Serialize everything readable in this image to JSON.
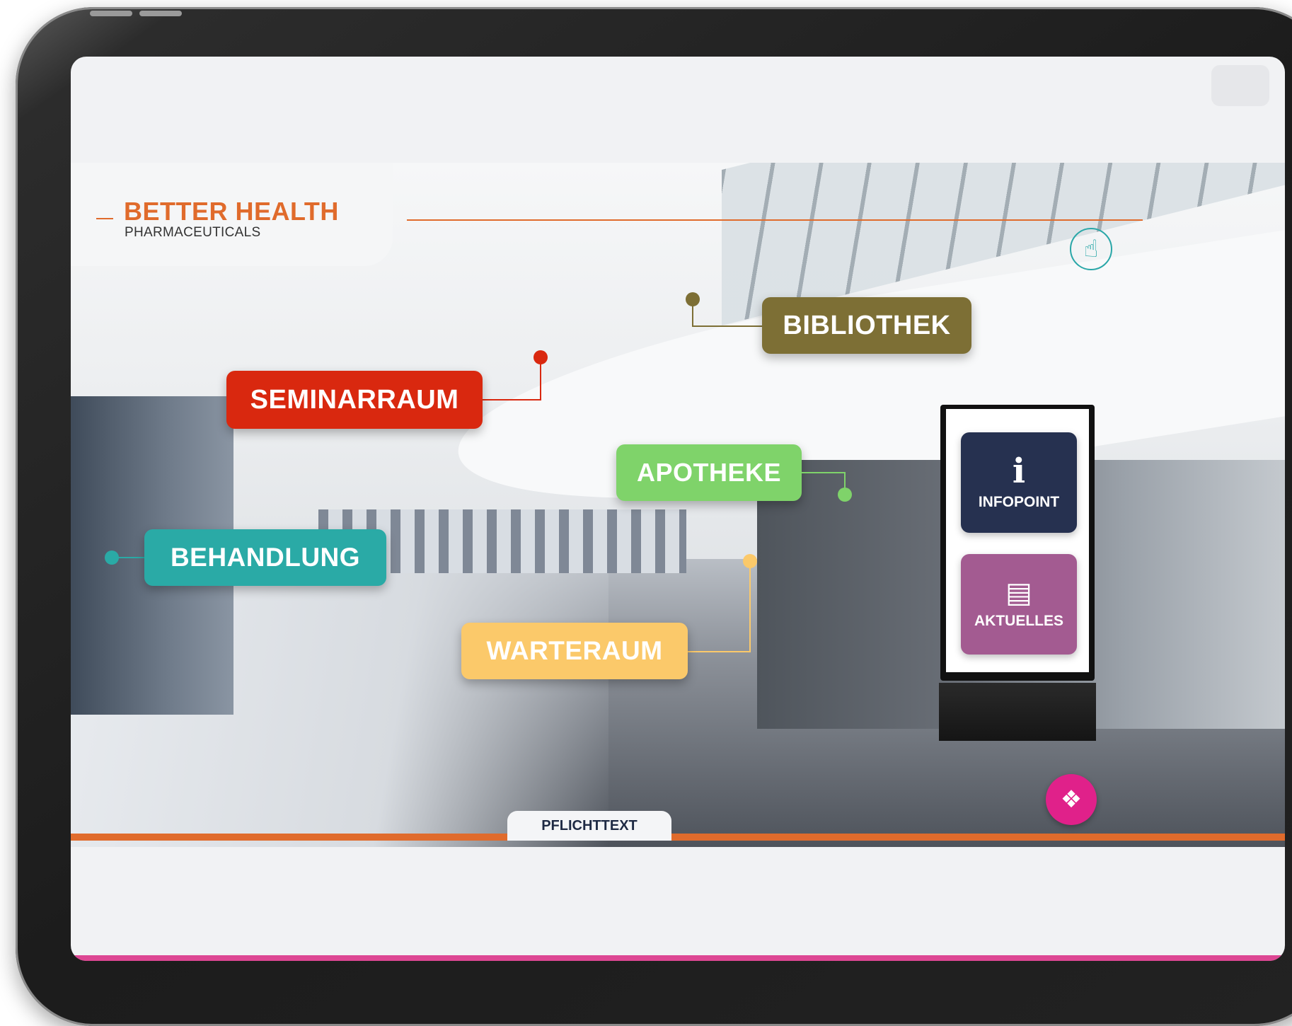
{
  "brand": {
    "name": "BETTER HEALTH",
    "subtitle": "PHARMACEUTICALS"
  },
  "colors": {
    "accent_orange": "#e06b2c",
    "seminarraum": "#d9280f",
    "bibliothek": "#7d6f35",
    "apotheke": "#7fd36a",
    "behandlung": "#2aaaa6",
    "warteraum": "#fbc96a",
    "infopoint": "#263150",
    "aktuelles": "#a35b91",
    "brand_pink": "#e0218a"
  },
  "hotspots": {
    "seminarraum": "SEMINARRAUM",
    "bibliothek": "BIBLIOTHEK",
    "apotheke": "APOTHEKE",
    "behandlung": "BEHANDLUNG",
    "warteraum": "WARTERAUM"
  },
  "kiosk": {
    "infopoint_label": "INFOPOINT",
    "infopoint_icon": "info-icon",
    "aktuelles_label": "AKTUELLES",
    "aktuelles_icon": "newspaper-icon"
  },
  "footer": {
    "pflichttext_label": "PFLICHTTEXT"
  },
  "icons": {
    "hand_hint": "pointer-hand-icon",
    "brand_fab": "brand-logo-icon"
  }
}
